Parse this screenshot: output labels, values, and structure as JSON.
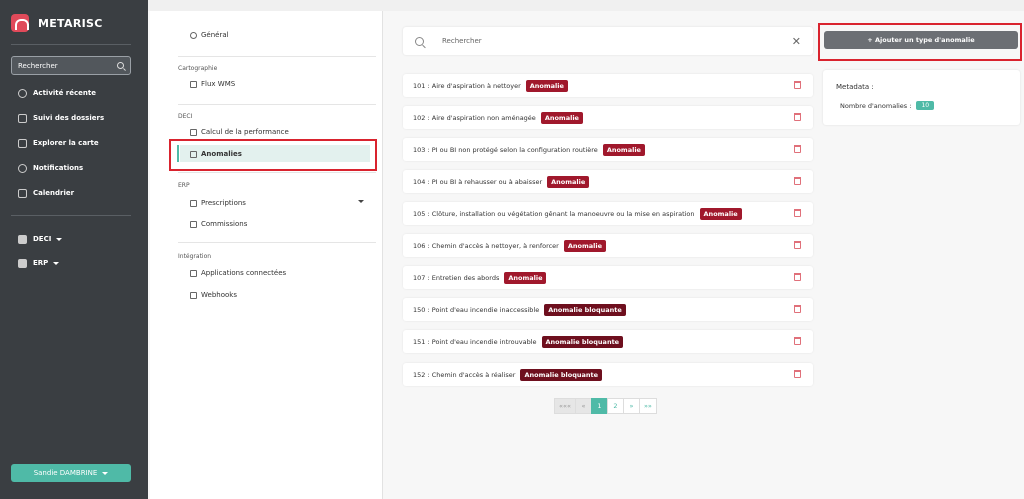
{
  "sidebar": {
    "brand": "METARISC",
    "search_placeholder": "Rechercher",
    "items": [
      {
        "label": "Activité récente"
      },
      {
        "label": "Suivi des dossiers"
      },
      {
        "label": "Explorer la carte"
      },
      {
        "label": "Notifications"
      },
      {
        "label": "Calendrier"
      }
    ],
    "groups": [
      {
        "label": "DECI"
      },
      {
        "label": "ERP"
      }
    ],
    "user": "Sandie DAMBRINE"
  },
  "subnav": {
    "general": "Général",
    "sections": [
      {
        "title": "Cartographie",
        "items": [
          "Flux WMS"
        ]
      },
      {
        "title": "DECI",
        "items": [
          "Calcul de la performance",
          "Anomalies"
        ]
      },
      {
        "title": "ERP",
        "items": [
          "Prescriptions",
          "Commissions"
        ]
      },
      {
        "title": "Intégration",
        "items": [
          "Applications connectées",
          "Webhooks"
        ]
      }
    ]
  },
  "search": {
    "placeholder": "Rechercher"
  },
  "anomalies": [
    {
      "code": "101 :",
      "label": "Aire d'aspiration à nettoyer",
      "badge": "Anomalie"
    },
    {
      "code": "102 :",
      "label": "Aire d'aspiration non aménagée",
      "badge": "Anomalie"
    },
    {
      "code": "103 :",
      "label": "PI ou BI non protégé selon la configuration routière",
      "badge": "Anomalie"
    },
    {
      "code": "104 :",
      "label": "PI ou BI à rehausser ou à abaisser",
      "badge": "Anomalie"
    },
    {
      "code": "105 :",
      "label": "Clôture, installation ou végétation gênant la manoeuvre ou la mise en aspiration",
      "badge": "Anomalie"
    },
    {
      "code": "106 :",
      "label": "Chemin d'accès à nettoyer, à renforcer",
      "badge": "Anomalie"
    },
    {
      "code": "107 :",
      "label": "Entretien des abords",
      "badge": "Anomalie"
    },
    {
      "code": "150 :",
      "label": "Point d'eau incendie inaccessible",
      "badge": "Anomalie bloquante"
    },
    {
      "code": "151 :",
      "label": "Point d'eau incendie introuvable",
      "badge": "Anomalie bloquante"
    },
    {
      "code": "152 :",
      "label": "Chemin d'accès à réaliser",
      "badge": "Anomalie bloquante"
    }
  ],
  "colors": {
    "badge": "#a0182c",
    "badge_bloquante": "#6e0f1e",
    "accent": "#4fbaa7"
  },
  "pagination": {
    "first": "«««",
    "prev": "«",
    "pages": [
      "1",
      "2"
    ],
    "current": "1",
    "next": "»",
    "last": "»»"
  },
  "toolbar": {
    "add_label": "+ Ajouter un type d'anomalie"
  },
  "metadata": {
    "title": "Metadata :",
    "count_label": "Nombre d'anomalies :",
    "count": "10"
  }
}
